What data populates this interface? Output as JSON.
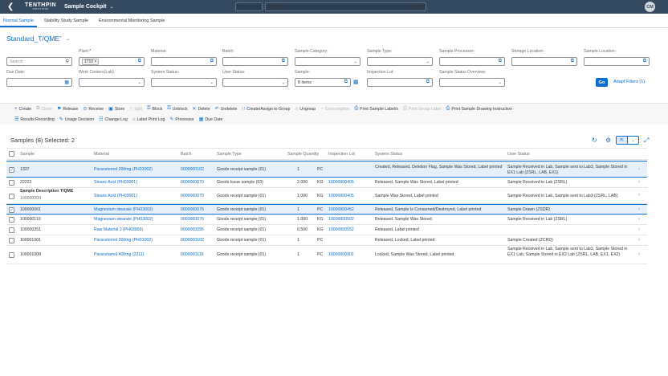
{
  "shell": {
    "logo_main": "TENTHPIN",
    "logo_sub": "SOLUTIONS",
    "app_title": "Sample Cockpit",
    "scope": "All",
    "search_placeholder": "Search",
    "avatar": "CM"
  },
  "tabs": [
    {
      "label": "Normal Sample"
    },
    {
      "label": "Stability Study Sample"
    },
    {
      "label": "Environmental Monitoring Sample"
    }
  ],
  "variant": {
    "name": "Standard_T/QME",
    "dirty": "*"
  },
  "filters": {
    "search_placeholder": "Search",
    "plant_label": "Plant:",
    "plant_required": "*",
    "plant_token": "1710",
    "material_label": "Material:",
    "batch_label": "Batch:",
    "sample_category_label": "Sample Category:",
    "sample_type_label": "Sample Type:",
    "sample_processor_label": "Sample Processor:",
    "storage_location_label": "Storage Location:",
    "sample_location_label": "Sample Location:",
    "due_date_label": "Due Date:",
    "work_centers_label": "Work Centers(Lab):",
    "system_status_label": "System Status:",
    "user_status_label": "User Status:",
    "sample_label": "Sample:",
    "sample_value": "8 Items",
    "inspection_lot_label": "Inspection Lot:",
    "sample_status_overview_label": "Sample Status Overview:",
    "go": "Go",
    "adapt": "Adapt Filters (1)"
  },
  "toolbar": {
    "row1": [
      {
        "label": "Create",
        "icon": "plus-icon",
        "disabled": false
      },
      {
        "label": "Clone",
        "icon": "copy-icon",
        "disabled": true
      },
      {
        "label": "Release",
        "icon": "flag-icon",
        "disabled": false
      },
      {
        "label": "Receive",
        "icon": "receive-icon",
        "disabled": false
      },
      {
        "label": "Store",
        "icon": "save-icon",
        "disabled": false
      },
      {
        "label": "Split",
        "icon": "split-icon",
        "disabled": true
      },
      {
        "label": "Block",
        "icon": "lock-icon",
        "disabled": false
      },
      {
        "label": "Unblock",
        "icon": "unlock-icon",
        "disabled": false
      },
      {
        "label": "Delete",
        "icon": "delete-icon",
        "disabled": false
      },
      {
        "label": "Undelete",
        "icon": "undo-icon",
        "disabled": false
      },
      {
        "label": "Create/Assign to Group",
        "icon": "group-icon",
        "disabled": false
      },
      {
        "label": "Ungroup",
        "icon": "ungroup-icon",
        "disabled": false
      },
      {
        "label": "Consumption",
        "icon": "consumption-icon",
        "disabled": true
      },
      {
        "label": "Print Sample Label/s",
        "icon": "print-icon",
        "disabled": false
      },
      {
        "label": "Print Group Label",
        "icon": "print-icon",
        "disabled": true
      },
      {
        "label": "Print Sample Drawing Instruction",
        "icon": "print-icon",
        "disabled": false
      }
    ],
    "row2": [
      {
        "label": "Results Recording",
        "icon": "results-icon",
        "disabled": false
      },
      {
        "label": "Usage Decision",
        "icon": "decision-icon",
        "disabled": false
      },
      {
        "label": "Change Log",
        "icon": "log-icon",
        "disabled": false
      },
      {
        "label": "Label Print Log",
        "icon": "label-icon",
        "disabled": false
      },
      {
        "label": "Processor",
        "icon": "processor-icon",
        "disabled": false
      },
      {
        "label": "Due Date",
        "icon": "calendar-icon",
        "disabled": false
      }
    ]
  },
  "table": {
    "title": "Samples (8)  Selected: 2",
    "columns": [
      "Sample",
      "Material",
      "Batch",
      "Sample Type",
      "Sample Quantity",
      "Inspection Lot",
      "System Status",
      "User Status"
    ],
    "rows": [
      {
        "selected": true,
        "sample": "1337",
        "sample_desc": "",
        "material": "Paracetemol 200mg (PH01002)",
        "batch": "0000000102",
        "type": "Goods receipt sample (01)",
        "qty": "1",
        "unit": "PC",
        "lot": "",
        "sys": "Created, Released, Deletion Flag, Sample Was Stored, Label printed",
        "user": "Sample Received in Lab, Sample sent to Lab3, Sample Stored in EX1 Lab (ZSRL, LAB, EX1)"
      },
      {
        "selected": false,
        "sample": "22222",
        "sample_desc": "",
        "material": "Stearic Acid (PH03001)",
        "batch": "0000000070",
        "type": "Goods Issue sample (03)",
        "qty": "2.000",
        "unit": "KG",
        "lot": "10000000405",
        "sys": "Released, Sample Was Stored, Label printed",
        "user": "Sample Received in Lab (ZSRL)"
      },
      {
        "selected": false,
        "sample": "Sample Description T/QME",
        "sample_desc": "100000000",
        "material": "Stearic Acid (PH03001)",
        "batch": "0000000070",
        "type": "Goods receipt sample (01)",
        "qty": "1.000",
        "unit": "KG",
        "lot": "10000000405",
        "sys": "Sample Was Stored, Label printed",
        "user": "Sample Received in Lab, Sample sent to Lab3 (ZSRL, LAB)"
      },
      {
        "selected": true,
        "sample": "100000061",
        "sample_desc": "",
        "material": "Magnesium stearate (PH03002)",
        "batch": "0000000075",
        "type": "Goods receipt sample (01)",
        "qty": "1",
        "unit": "PC",
        "lot": "10000000452",
        "sys": "Released, Sample Is Consumed/Destroyed, Label printed",
        "user": "Sample Drawn (ZSDR)"
      },
      {
        "selected": false,
        "sample": "100000110",
        "sample_desc": "",
        "material": "Magnesium stearate (PH03002)",
        "batch": "0000000076",
        "type": "Goods receipt sample (01)",
        "qty": "1.000",
        "unit": "KG",
        "lot": "10000000502",
        "sys": "Released, Sample Was Stored",
        "user": "Sample Received in Lab (ZSRL)"
      },
      {
        "selected": false,
        "sample": "100000351",
        "sample_desc": "",
        "material": "Raw Material 3 (PH03003)",
        "batch": "0000000095",
        "type": "Goods receipt sample (01)",
        "qty": "0.500",
        "unit": "KG",
        "lot": "10000000552",
        "sys": "Released, Label printed",
        "user": ""
      },
      {
        "selected": false,
        "sample": "100001001",
        "sample_desc": "",
        "material": "Paracetemol 200mg (PH01002)",
        "batch": "0000000102",
        "type": "Goods receipt sample (01)",
        "qty": "1",
        "unit": "PC",
        "lot": "",
        "sys": "Released, Locked, Label printed",
        "user": "Sample Created (ZCRD)"
      },
      {
        "selected": false,
        "sample": "100001008",
        "sample_desc": "",
        "material": "Paracetamol 400mg (2211)",
        "batch": "0000000116",
        "type": "Goods receipt sample (01)",
        "qty": "1",
        "unit": "PC",
        "lot": "10000000901",
        "sys": "Locked, Sample Was Stored, Label printed",
        "user": "Sample Received in Lab, Sample sent to Lab3, Sample Stored in EX1 Lab, Sample Stored in EX2 Lab (ZSRL, LAB, EX1, EX2)"
      }
    ]
  }
}
